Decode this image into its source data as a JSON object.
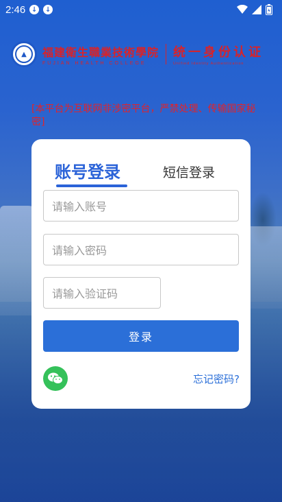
{
  "status_bar": {
    "time": "2:46"
  },
  "header": {
    "school_name_cn": "福建衛生職業技術學院",
    "school_name_en": "FUJIAN   HEALTH   COLLEGE",
    "auth_title": "统一身份认证",
    "auth_subtitle": "Unified Identity Authentication"
  },
  "notice": {
    "text": "[本平台为互联网非涉密平台，严禁处理、传输国家秘密]"
  },
  "login": {
    "tabs": [
      {
        "label": "账号登录",
        "active": true
      },
      {
        "label": "短信登录",
        "active": false
      }
    ],
    "account_placeholder": "请输入账号",
    "password_placeholder": "请输入密码",
    "captcha_placeholder": "请输入验证码",
    "submit_label": "登录",
    "forgot_label": "忘记密码?"
  },
  "colors": {
    "accent": "#2b6fd8",
    "warning": "#e2232a",
    "wechat": "#35c15a"
  }
}
